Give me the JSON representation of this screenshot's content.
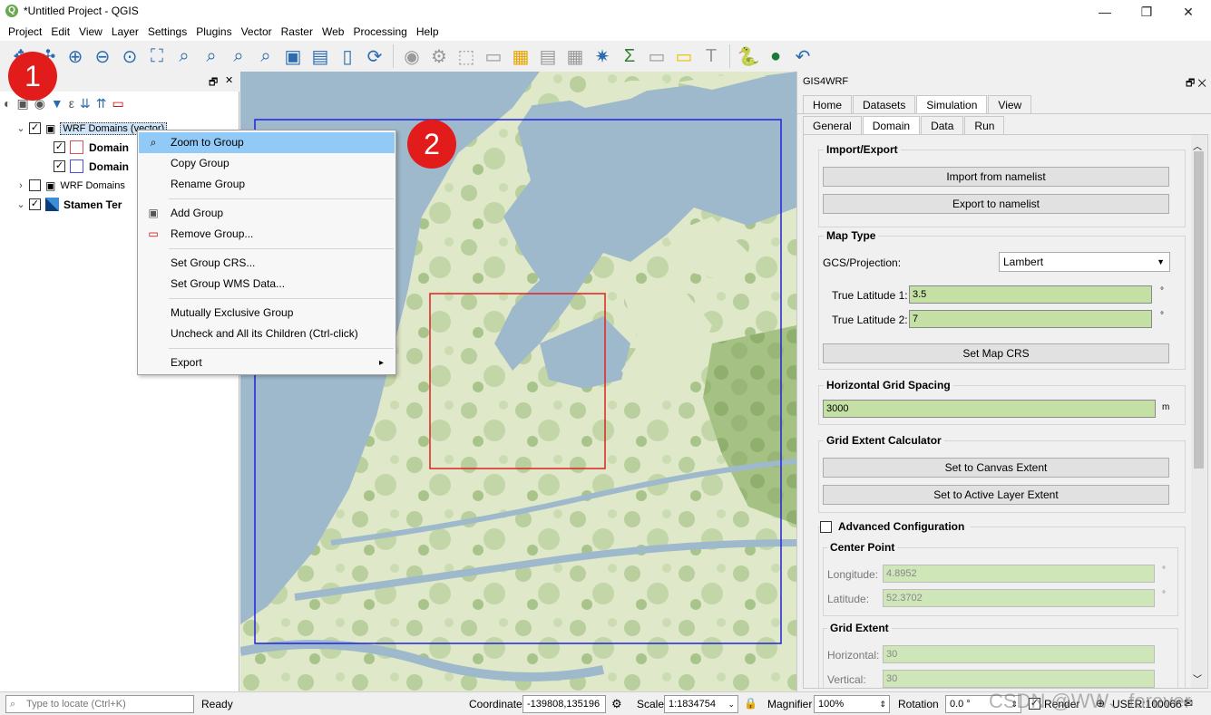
{
  "window": {
    "title": "*Untitled Project - QGIS",
    "minimize": "—",
    "maximize": "❐",
    "close": "✕"
  },
  "menu": [
    "Project",
    "Edit",
    "View",
    "Layer",
    "Settings",
    "Plugins",
    "Vector",
    "Raster",
    "Web",
    "Processing",
    "Help"
  ],
  "layers_panel": {
    "float_glyph": "🗗",
    "close_glyph": "✕",
    "items": [
      {
        "label": "WRF Domains (vector)",
        "checked": true,
        "expanded": true
      },
      {
        "label": "Domain",
        "checked": true
      },
      {
        "label": "Domain",
        "checked": true
      },
      {
        "label": "WRF Domains",
        "checked": false,
        "expanded": false
      },
      {
        "label": "Stamen Ter",
        "checked": true,
        "expanded": true
      }
    ]
  },
  "badges": {
    "one": "1",
    "two": "2"
  },
  "context_menu": {
    "items": [
      {
        "label": "Zoom to Group",
        "highlighted": true
      },
      {
        "label": "Copy Group"
      },
      {
        "label": "Rename Group"
      },
      {
        "label": "Add Group"
      },
      {
        "label": "Remove Group..."
      },
      {
        "label": "Set Group CRS..."
      },
      {
        "label": "Set Group WMS Data..."
      },
      {
        "label": "Mutually Exclusive Group"
      },
      {
        "label": "Uncheck and All its Children (Ctrl-click)"
      },
      {
        "label": "Export"
      }
    ],
    "submenu_glyph": "▸"
  },
  "plugin": {
    "title": "GIS4WRF",
    "float_close": "🗗 ✕",
    "main_tabs": [
      "Home",
      "Datasets",
      "Simulation",
      "View"
    ],
    "sub_tabs": [
      "General",
      "Domain",
      "Data",
      "Run"
    ],
    "import_export": {
      "title": "Import/Export",
      "import_btn": "Import from namelist",
      "export_btn": "Export to namelist"
    },
    "map_type": {
      "title": "Map Type",
      "gcs_label": "GCS/Projection:",
      "gcs_value": "Lambert",
      "tl1_label": "True Latitude 1:",
      "tl1_value": "3.5",
      "tl2_label": "True Latitude 2:",
      "tl2_value": "7",
      "deg": "°",
      "set_crs_btn": "Set Map CRS"
    },
    "grid_spacing": {
      "title": "Horizontal Grid Spacing",
      "value": "3000",
      "unit": "m"
    },
    "extent_calc": {
      "title": "Grid Extent Calculator",
      "canvas_btn": "Set to Canvas Extent",
      "layer_btn": "Set to Active Layer Extent"
    },
    "advanced": {
      "title": "Advanced Configuration",
      "center_title": "Center Point",
      "lon_label": "Longitude:",
      "lon_value": "4.8952",
      "lat_label": "Latitude:",
      "lat_value": "52.3702",
      "extent_title": "Grid Extent",
      "hor_label": "Horizontal:",
      "hor_value": "30",
      "ver_label": "Vertical:",
      "ver_value": "30"
    }
  },
  "status": {
    "locate_placeholder": "Type to locate (Ctrl+K)",
    "ready": "Ready",
    "coordinate_label": "Coordinate",
    "coordinate_value": "-139808,135196",
    "scale_label": "Scale",
    "scale_value": "1:1834754",
    "magnifier_label": "Magnifier",
    "magnifier_value": "100%",
    "rotation_label": "Rotation",
    "rotation_value": "0.0 °",
    "render_label": "Render",
    "crs_label": "USER:100066",
    "watermark": "CSDN @WW、forever"
  },
  "colors": {
    "highlight": "#91c9f7",
    "badge": "#e21b1b",
    "field": "#c5e0a5",
    "water": "#9fb9cc",
    "land": "#dfe8c9"
  }
}
